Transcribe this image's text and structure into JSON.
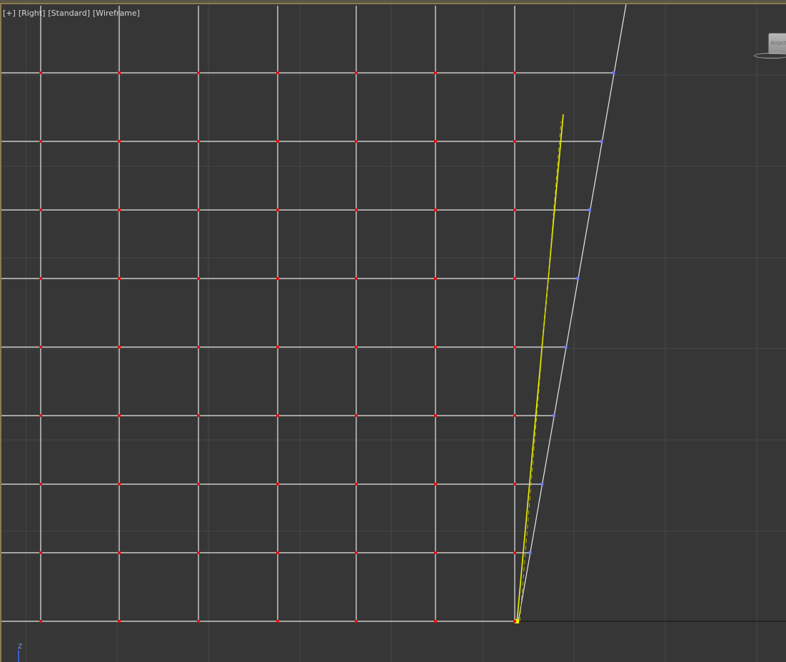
{
  "viewport": {
    "menu": {
      "plus_label": "[+]",
      "view_label": "[Right]",
      "shading_label": "[Standard]",
      "display_label": "[Wireframe]"
    },
    "viewcube": {
      "face_label": "RIGHT"
    },
    "axis": {
      "label": "Z"
    },
    "colors": {
      "background": "#363636",
      "grid_line": "#474747",
      "wire_edge": "#e8e8e8",
      "vertex_marker": "#e01010",
      "selected_vertex": "#6e78ff",
      "spline": "#f2f200",
      "spline_dashed": "#b0b000",
      "frame_accent": "#8b7b4a"
    }
  }
}
